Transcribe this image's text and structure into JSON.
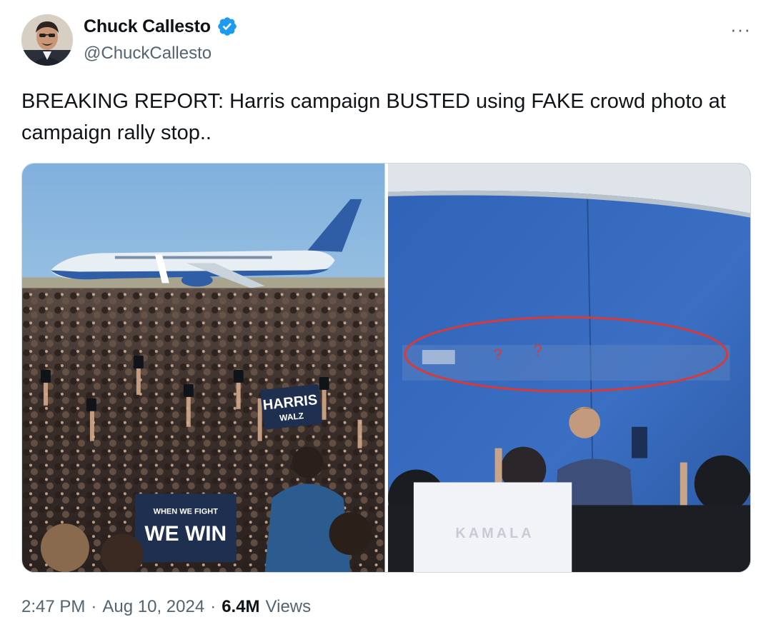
{
  "author": {
    "name": "Chuck Callesto",
    "handle": "@ChuckCallesto",
    "verified": true,
    "verified_icon": "verified-badge-icon",
    "verified_color": "#1d9bf0"
  },
  "more_icon": "more-options-icon",
  "more_label": "···",
  "tweet": {
    "text": "BREAKING REPORT: Harris campaign BUSTED using FAKE crowd photo at campaign rally stop.."
  },
  "media": {
    "left_signs": {
      "harris": "HARRIS",
      "walz": "WALZ",
      "fight": "WHEN WE FIGHT",
      "win": "WE WIN"
    },
    "right_signs": {
      "kamala": "KAMALA"
    }
  },
  "footer": {
    "time": "2:47 PM",
    "sep1": "·",
    "date": "Aug 10, 2024",
    "sep2": "·",
    "views_count": "6.4M",
    "views_label": "Views"
  }
}
